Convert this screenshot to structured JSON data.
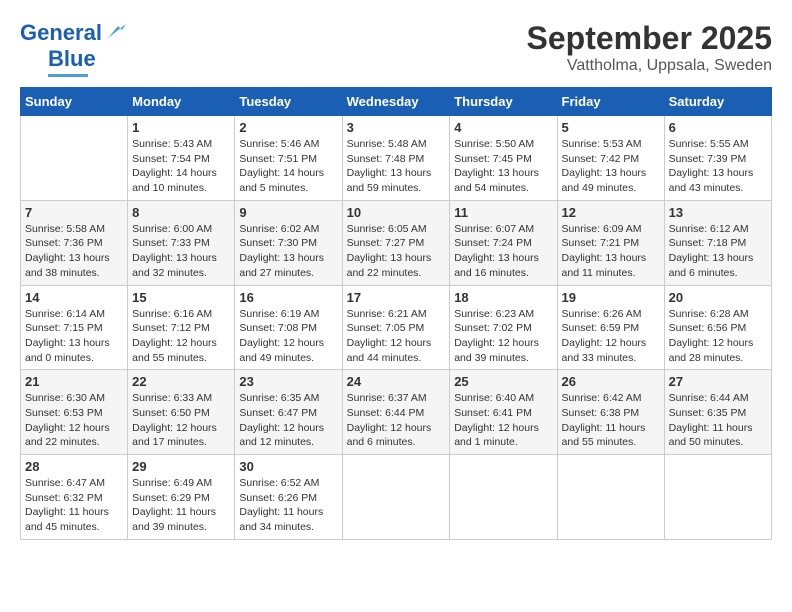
{
  "header": {
    "logo_general": "General",
    "logo_blue": "Blue",
    "title": "September 2025",
    "subtitle": "Vattholma, Uppsala, Sweden"
  },
  "days_of_week": [
    "Sunday",
    "Monday",
    "Tuesday",
    "Wednesday",
    "Thursday",
    "Friday",
    "Saturday"
  ],
  "weeks": [
    [
      {
        "num": "",
        "info": ""
      },
      {
        "num": "1",
        "info": "Sunrise: 5:43 AM\nSunset: 7:54 PM\nDaylight: 14 hours\nand 10 minutes."
      },
      {
        "num": "2",
        "info": "Sunrise: 5:46 AM\nSunset: 7:51 PM\nDaylight: 14 hours\nand 5 minutes."
      },
      {
        "num": "3",
        "info": "Sunrise: 5:48 AM\nSunset: 7:48 PM\nDaylight: 13 hours\nand 59 minutes."
      },
      {
        "num": "4",
        "info": "Sunrise: 5:50 AM\nSunset: 7:45 PM\nDaylight: 13 hours\nand 54 minutes."
      },
      {
        "num": "5",
        "info": "Sunrise: 5:53 AM\nSunset: 7:42 PM\nDaylight: 13 hours\nand 49 minutes."
      },
      {
        "num": "6",
        "info": "Sunrise: 5:55 AM\nSunset: 7:39 PM\nDaylight: 13 hours\nand 43 minutes."
      }
    ],
    [
      {
        "num": "7",
        "info": "Sunrise: 5:58 AM\nSunset: 7:36 PM\nDaylight: 13 hours\nand 38 minutes."
      },
      {
        "num": "8",
        "info": "Sunrise: 6:00 AM\nSunset: 7:33 PM\nDaylight: 13 hours\nand 32 minutes."
      },
      {
        "num": "9",
        "info": "Sunrise: 6:02 AM\nSunset: 7:30 PM\nDaylight: 13 hours\nand 27 minutes."
      },
      {
        "num": "10",
        "info": "Sunrise: 6:05 AM\nSunset: 7:27 PM\nDaylight: 13 hours\nand 22 minutes."
      },
      {
        "num": "11",
        "info": "Sunrise: 6:07 AM\nSunset: 7:24 PM\nDaylight: 13 hours\nand 16 minutes."
      },
      {
        "num": "12",
        "info": "Sunrise: 6:09 AM\nSunset: 7:21 PM\nDaylight: 13 hours\nand 11 minutes."
      },
      {
        "num": "13",
        "info": "Sunrise: 6:12 AM\nSunset: 7:18 PM\nDaylight: 13 hours\nand 6 minutes."
      }
    ],
    [
      {
        "num": "14",
        "info": "Sunrise: 6:14 AM\nSunset: 7:15 PM\nDaylight: 13 hours\nand 0 minutes."
      },
      {
        "num": "15",
        "info": "Sunrise: 6:16 AM\nSunset: 7:12 PM\nDaylight: 12 hours\nand 55 minutes."
      },
      {
        "num": "16",
        "info": "Sunrise: 6:19 AM\nSunset: 7:08 PM\nDaylight: 12 hours\nand 49 minutes."
      },
      {
        "num": "17",
        "info": "Sunrise: 6:21 AM\nSunset: 7:05 PM\nDaylight: 12 hours\nand 44 minutes."
      },
      {
        "num": "18",
        "info": "Sunrise: 6:23 AM\nSunset: 7:02 PM\nDaylight: 12 hours\nand 39 minutes."
      },
      {
        "num": "19",
        "info": "Sunrise: 6:26 AM\nSunset: 6:59 PM\nDaylight: 12 hours\nand 33 minutes."
      },
      {
        "num": "20",
        "info": "Sunrise: 6:28 AM\nSunset: 6:56 PM\nDaylight: 12 hours\nand 28 minutes."
      }
    ],
    [
      {
        "num": "21",
        "info": "Sunrise: 6:30 AM\nSunset: 6:53 PM\nDaylight: 12 hours\nand 22 minutes."
      },
      {
        "num": "22",
        "info": "Sunrise: 6:33 AM\nSunset: 6:50 PM\nDaylight: 12 hours\nand 17 minutes."
      },
      {
        "num": "23",
        "info": "Sunrise: 6:35 AM\nSunset: 6:47 PM\nDaylight: 12 hours\nand 12 minutes."
      },
      {
        "num": "24",
        "info": "Sunrise: 6:37 AM\nSunset: 6:44 PM\nDaylight: 12 hours\nand 6 minutes."
      },
      {
        "num": "25",
        "info": "Sunrise: 6:40 AM\nSunset: 6:41 PM\nDaylight: 12 hours\nand 1 minute."
      },
      {
        "num": "26",
        "info": "Sunrise: 6:42 AM\nSunset: 6:38 PM\nDaylight: 11 hours\nand 55 minutes."
      },
      {
        "num": "27",
        "info": "Sunrise: 6:44 AM\nSunset: 6:35 PM\nDaylight: 11 hours\nand 50 minutes."
      }
    ],
    [
      {
        "num": "28",
        "info": "Sunrise: 6:47 AM\nSunset: 6:32 PM\nDaylight: 11 hours\nand 45 minutes."
      },
      {
        "num": "29",
        "info": "Sunrise: 6:49 AM\nSunset: 6:29 PM\nDaylight: 11 hours\nand 39 minutes."
      },
      {
        "num": "30",
        "info": "Sunrise: 6:52 AM\nSunset: 6:26 PM\nDaylight: 11 hours\nand 34 minutes."
      },
      {
        "num": "",
        "info": ""
      },
      {
        "num": "",
        "info": ""
      },
      {
        "num": "",
        "info": ""
      },
      {
        "num": "",
        "info": ""
      }
    ]
  ]
}
